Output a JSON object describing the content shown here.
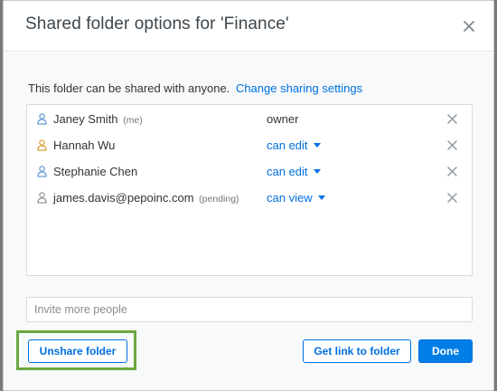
{
  "dialog": {
    "title": "Shared folder options for 'Finance'",
    "close_icon": "close-icon"
  },
  "intro": {
    "text": "This folder can be shared with anyone.",
    "link": "Change sharing settings"
  },
  "members": [
    {
      "name": "Janey Smith",
      "tag": "(me)",
      "permission": "owner",
      "permission_is_dropdown": false,
      "icon": "user-icon",
      "icon_color": "#6b9ed6"
    },
    {
      "name": "Hannah Wu",
      "tag": "",
      "permission": "can edit",
      "permission_is_dropdown": true,
      "icon": "user-icon",
      "icon_color": "#d9a23a"
    },
    {
      "name": "Stephanie Chen",
      "tag": "",
      "permission": "can edit",
      "permission_is_dropdown": true,
      "icon": "user-icon",
      "icon_color": "#6b9ed6"
    },
    {
      "name": "james.davis@pepoinc.com",
      "tag": "(pending)",
      "permission": "can view",
      "permission_is_dropdown": true,
      "icon": "user-icon",
      "icon_color": "#9a9a9a"
    }
  ],
  "invite": {
    "placeholder": "Invite more people",
    "value": ""
  },
  "buttons": {
    "unshare": "Unshare folder",
    "get_link": "Get link to folder",
    "done": "Done"
  },
  "colors": {
    "accent": "#0070e0",
    "primary_button": "#007ee5",
    "highlight": "#6aa742"
  }
}
